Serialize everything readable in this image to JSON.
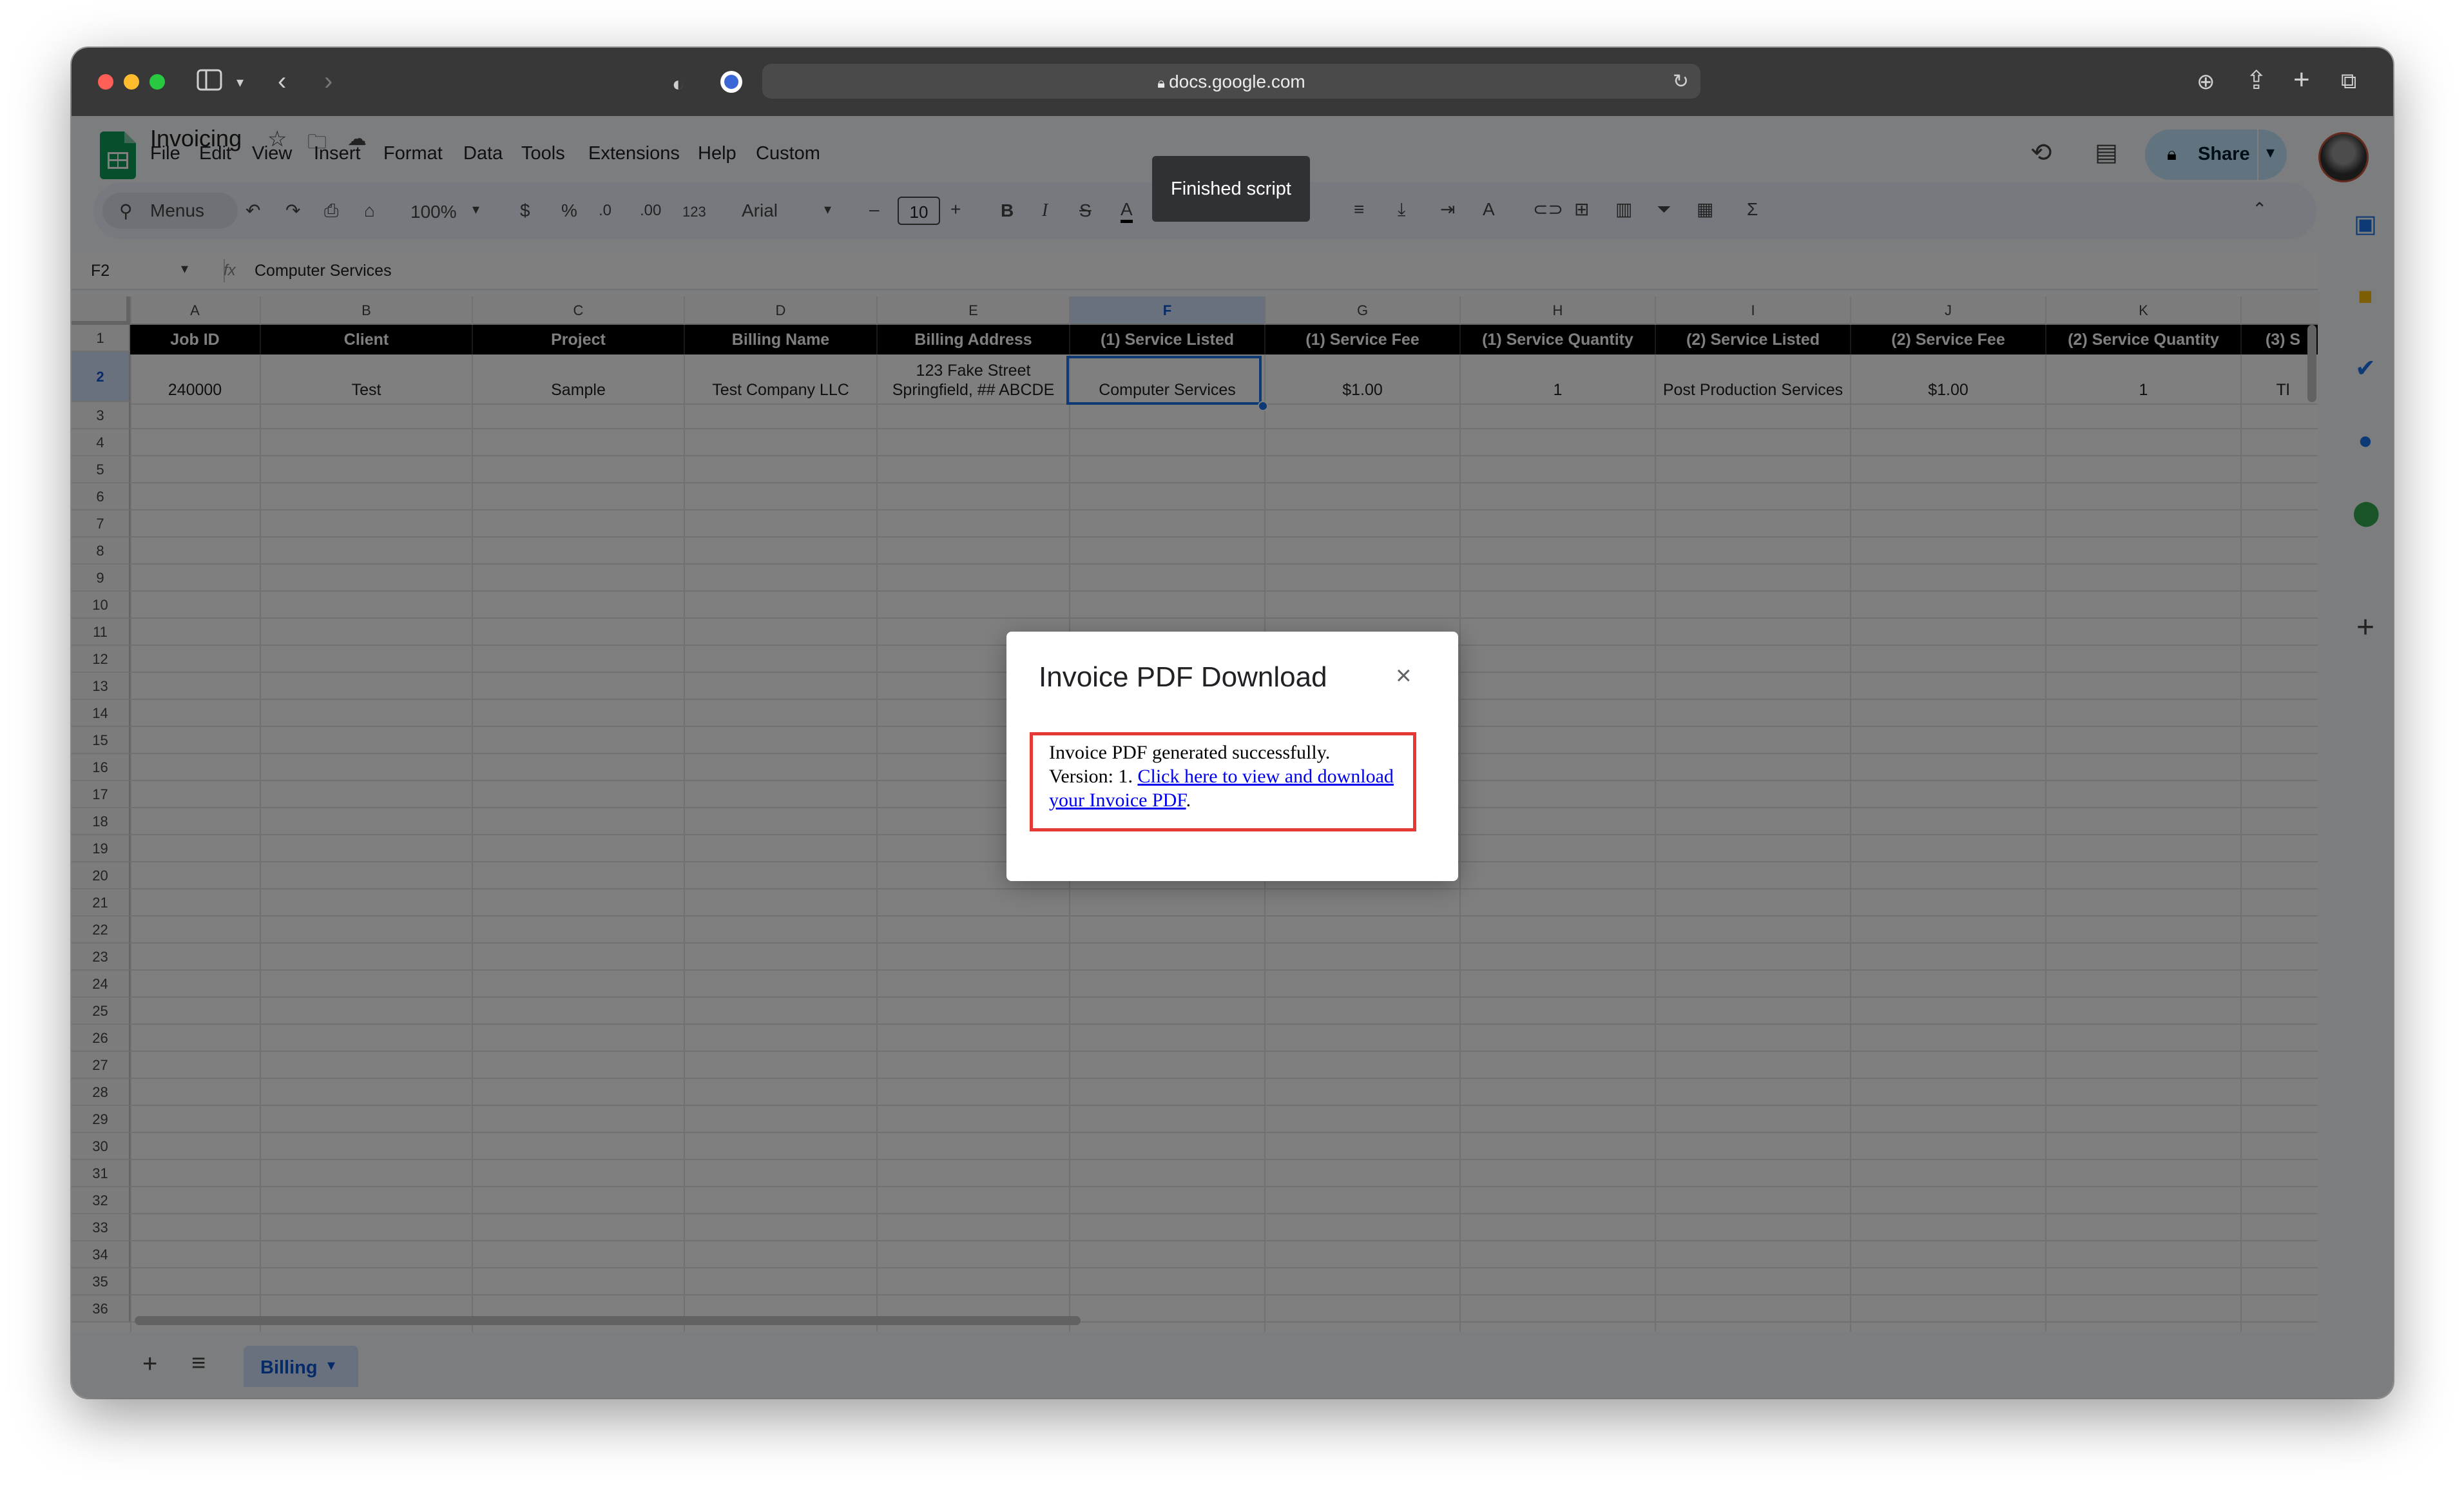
{
  "browser": {
    "url": "docs.google.com"
  },
  "doc": {
    "title": "Invoicing",
    "menus": [
      "File",
      "Edit",
      "View",
      "Insert",
      "Format",
      "Data",
      "Tools",
      "Extensions",
      "Help",
      "Custom"
    ],
    "share_label": "Share"
  },
  "toolbar": {
    "menus_label": "Menus",
    "zoom": "100%",
    "currency": "$",
    "percent": "%",
    "dec_decrease": ".0",
    "dec_increase": ".00",
    "number_format": "123",
    "font": "Arial",
    "font_size": "10"
  },
  "formula_bar": {
    "cell_ref": "F2",
    "fx": "fx",
    "value": "Computer Services"
  },
  "grid": {
    "columns": [
      "A",
      "B",
      "C",
      "D",
      "E",
      "F",
      "G",
      "H",
      "I",
      "J",
      "K"
    ],
    "selected_column": "F",
    "headers": [
      "Job ID",
      "Client",
      "Project",
      "Billing Name",
      "Billing Address",
      "(1) Service Listed",
      "(1) Service Fee",
      "(1) Service Quantity",
      "(2) Service Listed",
      "(2) Service Fee",
      "(2) Service Quantity",
      "(3) S"
    ],
    "row2": [
      "240000",
      "Test",
      "Sample",
      "Test Company LLC",
      "123 Fake Street\nSpringfield, ## ABCDE",
      "Computer Services",
      "$1.00",
      "1",
      "Post Production Services",
      "$1.00",
      "1",
      "Tl"
    ],
    "row_numbers": [
      "1",
      "2",
      "3",
      "4",
      "5",
      "6",
      "7",
      "8",
      "9",
      "10",
      "11",
      "12",
      "13",
      "14",
      "15",
      "16",
      "17",
      "18",
      "19",
      "20",
      "21",
      "22",
      "23",
      "24",
      "25",
      "26",
      "27",
      "28",
      "29",
      "30",
      "31",
      "32",
      "33",
      "34",
      "35",
      "36"
    ]
  },
  "sheet_tabs": {
    "active": "Billing"
  },
  "toast": {
    "text": "Finished script"
  },
  "dialog": {
    "title": "Invoice PDF Download",
    "message_prefix": "Invoice PDF generated successfully. Version: 1. ",
    "link_text": "Click here to view and download your Invoice PDF",
    "message_suffix": "."
  },
  "colors": {
    "accent": "#0b57d0",
    "highlight_border": "#e53935",
    "header_row_bg": "#000000"
  }
}
